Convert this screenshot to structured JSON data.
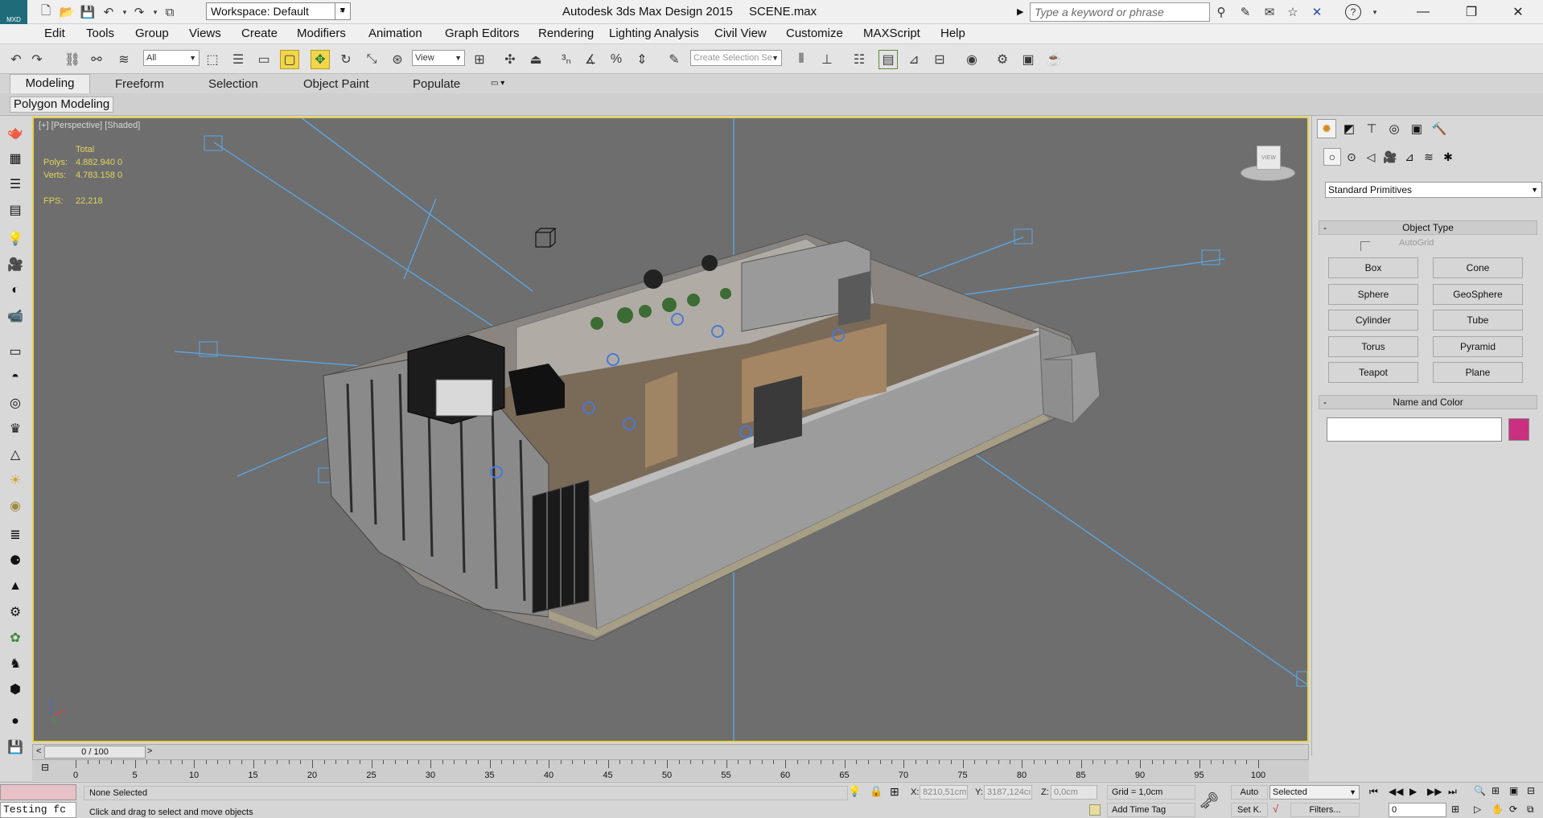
{
  "titlebar": {
    "workspace_label": "Workspace: Default",
    "app_title": "Autodesk 3ds Max Design 2015",
    "file_name": "SCENE.max",
    "search_placeholder": "Type a keyword or phrase",
    "logo_text": "MXD"
  },
  "menus": [
    "Edit",
    "Tools",
    "Group",
    "Views",
    "Create",
    "Modifiers",
    "Animation",
    "Graph Editors",
    "Rendering",
    "Lighting Analysis",
    "Civil View",
    "Customize",
    "MAXScript",
    "Help"
  ],
  "toolbar": {
    "selection_filter": "All",
    "ref_coord": "View",
    "selection_set_placeholder": "Create Selection Se"
  },
  "ribbon": {
    "tabs": [
      "Modeling",
      "Freeform",
      "Selection",
      "Object Paint",
      "Populate"
    ],
    "active_tab": "Modeling",
    "panel_label": "Polygon Modeling"
  },
  "viewport": {
    "label": "[+] [Perspective] [Shaded]",
    "stats_header": "Total",
    "polys_label": "Polys:",
    "polys_value": "4.882.940 0",
    "verts_label": "Verts:",
    "verts_value": "4.783.158 0",
    "fps_label": "FPS:",
    "fps_value": "22,218",
    "viewcube_label": "VIEW"
  },
  "command_panel": {
    "category": "Standard Primitives",
    "object_type_title": "Object Type",
    "autogrid_label": "AutoGrid",
    "primitives": [
      "Box",
      "Cone",
      "Sphere",
      "GeoSphere",
      "Cylinder",
      "Tube",
      "Torus",
      "Pyramid",
      "Teapot",
      "Plane"
    ],
    "name_color_title": "Name and Color",
    "object_color": "#c9307f"
  },
  "timeline": {
    "frame_display": "0 / 100",
    "ticks": [
      "0",
      "5",
      "10",
      "15",
      "20",
      "25",
      "30",
      "35",
      "40",
      "45",
      "50",
      "55",
      "60",
      "65",
      "70",
      "75",
      "80",
      "85",
      "90",
      "95",
      "100"
    ]
  },
  "status": {
    "listener_text": "Testing fc",
    "selection_status": "None Selected",
    "prompt": "Click and drag to select and move objects",
    "x_label": "X:",
    "x_value": "8210,51cm",
    "y_label": "Y:",
    "y_value": "3187,124cı",
    "z_label": "Z:",
    "z_value": "0,0cm",
    "grid": "Grid = 1,0cm",
    "add_time_tag": "Add Time Tag",
    "auto_key": "Auto",
    "set_key": "Set K.",
    "key_filter": "Selected",
    "filters": "Filters...",
    "current_frame": "0"
  },
  "colors": {
    "viewport_bg": "#6e6e6e",
    "active_border": "#e8d24a",
    "stats_text": "#e2d35a",
    "light_lines": "#5aa8e8"
  }
}
